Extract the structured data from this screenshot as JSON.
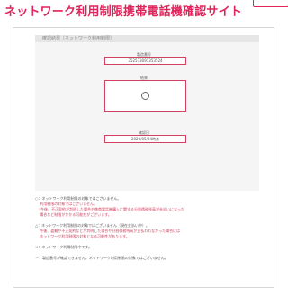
{
  "header": {
    "title": "ネットワーク利用制限携帯電話機確認サイト"
  },
  "result": {
    "section_title": "確認結果（ネットワーク利用制限）",
    "imei_label": "製造番号",
    "imei_value": "352573091353524",
    "status_label": "結果",
    "status_symbol": "○",
    "date_label": "確認日",
    "date_value": "2020/05/04時点"
  },
  "legend": {
    "lines": [
      "○：ネットワーク利用制限の対象ではございません。",
      "　 利用制限の対象ではございません。",
      "　（今後、不正契約が判明した場合や携帯電話機購入に関する分割債務残高が未払いになった",
      "　 場合など制限がかかる可能性がございます。）",
      "△：ネットワーク利用制限の対象ではございません（現在支払い中）。",
      "　 今後、盗難や不正契約などが判明した場合や分割債務残高が支払われなかった場合には",
      "　 ネットワーク利用制限の対象となる可能性があります。",
      "×：ネットワーク利用制限中です。",
      "－：製造番号が確認できません。ネットワーク利用制限の対象ではございません。"
    ]
  }
}
